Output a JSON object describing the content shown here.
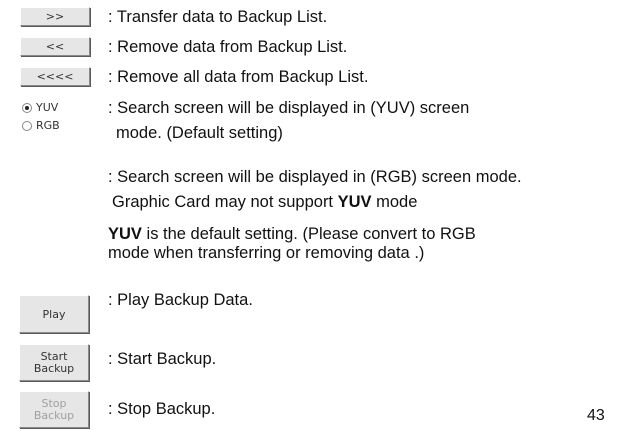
{
  "buttons": {
    "transfer": ">>",
    "remove": "<<",
    "remove_all": "<<<<",
    "play": "Play",
    "start_line1": "Start",
    "start_line2": "Backup",
    "stop_line1": "Stop",
    "stop_line2": "Backup"
  },
  "radio": {
    "yuv": "YUV",
    "rgb": "RGB",
    "selected": "YUV"
  },
  "descriptions": {
    "transfer": ": Transfer data to Backup List.",
    "remove": ": Remove data from Backup List.",
    "remove_all": ": Remove all data from Backup List.",
    "yuv_line1": ": Search screen will be displayed in (YUV) screen",
    "yuv_line2": "mode. (Default setting)",
    "rgb_line": ": Search screen will be displayed in (RGB) screen mode.",
    "graphic_prefix": "Graphic Card may not support ",
    "graphic_bold": "YUV",
    "graphic_suffix": " mode",
    "note_bold": "YUV",
    "note_line1_rest": " is the default setting. (Please convert to RGB",
    "note_line2": "mode when transferring or removing data .)",
    "play": ": Play Backup Data.",
    "start": ": Start Backup.",
    "stop": ": Stop Backup."
  },
  "page_number": "43"
}
